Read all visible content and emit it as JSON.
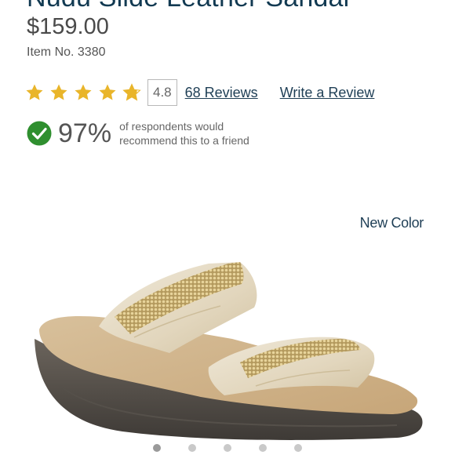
{
  "product": {
    "title": "Nudu Slide Leather Sandal",
    "price": "$159.00",
    "item_no": "Item No. 3380"
  },
  "rating": {
    "value": "4.8",
    "stars_filled": 4.8,
    "stars_total": 5,
    "star_color": "#e9b52a",
    "reviews_link": "68 Reviews",
    "write_review_link": "Write a Review"
  },
  "recommend": {
    "percent": "97%",
    "text": "of respondents would recommend this to a friend",
    "check_color": "#2f8f2f"
  },
  "gallery": {
    "badge": "New Color",
    "image_alt": "sandal-image",
    "dot_count": 5,
    "active_index": 0
  }
}
